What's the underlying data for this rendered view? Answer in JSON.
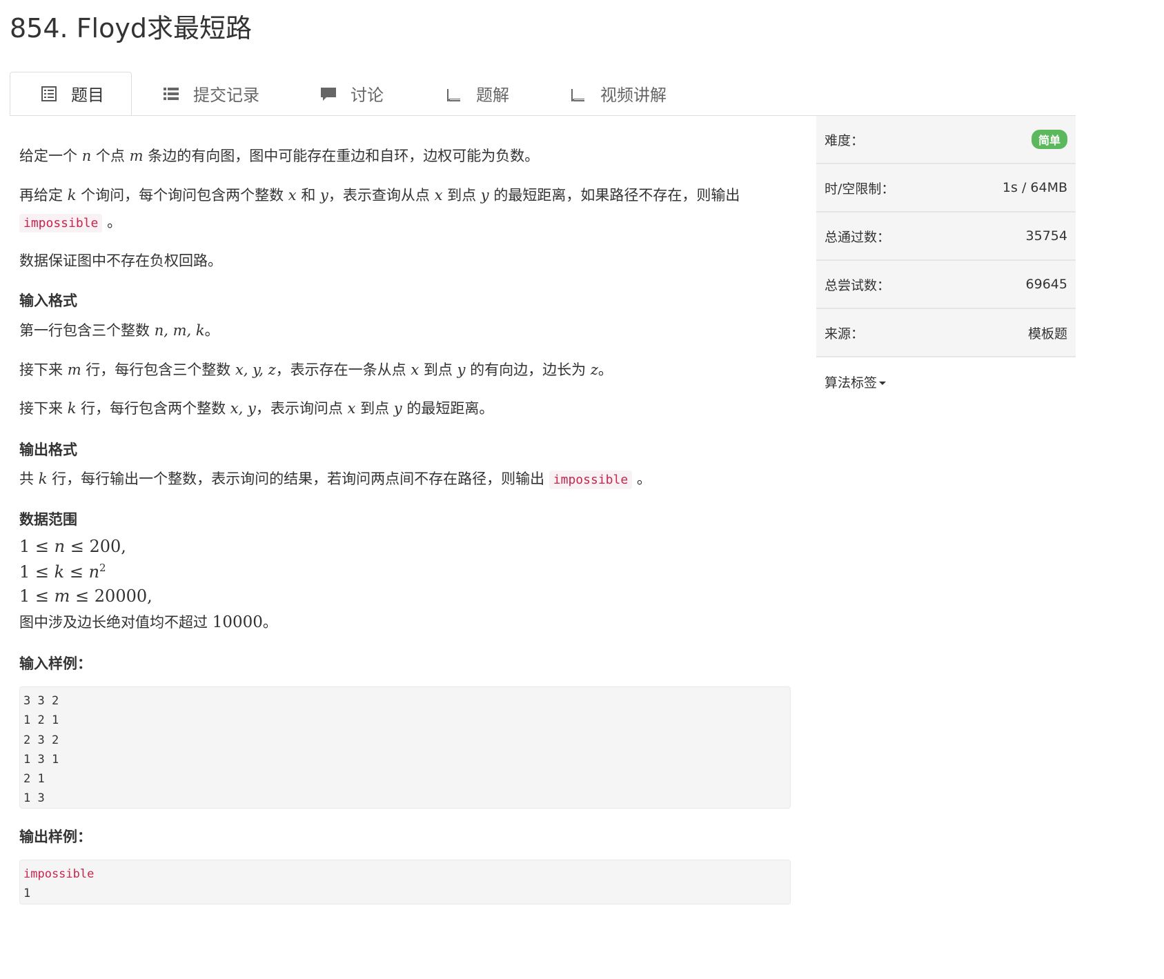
{
  "problem": {
    "title": "854. Floyd求最短路"
  },
  "tabs": [
    {
      "label": "题目",
      "icon": "list-alt-icon"
    },
    {
      "label": "提交记录",
      "icon": "list-icon"
    },
    {
      "label": "讨论",
      "icon": "comment-icon"
    },
    {
      "label": "题解",
      "icon": "book-icon"
    },
    {
      "label": "视频讲解",
      "icon": "book-icon"
    }
  ],
  "desc": {
    "p1_a": "给定一个",
    "p1_n": "n",
    "p1_b": "个点",
    "p1_m": "m",
    "p1_c": "条边的有向图，图中可能存在重边和自环，边权可能为负数。",
    "p2_a": "再给定",
    "p2_k": "k",
    "p2_b": "个询问，每个询问包含两个整数",
    "p2_x": "x",
    "p2_c": "和",
    "p2_y": "y",
    "p2_d": "，表示查询从点",
    "p2_x2": "x",
    "p2_e": "到点",
    "p2_y2": "y",
    "p2_f": "的最短距离，如果路径不存在，则输出",
    "p2_code": "impossible",
    "p2_end": "。",
    "p3": "数据保证图中不存在负权回路。"
  },
  "input_format": {
    "heading": "输入格式",
    "l1_a": "第一行包含三个整数",
    "l1_math": "n, m, k",
    "l1_end": "。",
    "l2_a": "接下来",
    "l2_m": "m",
    "l2_b": "行，每行包含三个整数",
    "l2_math": "x, y, z",
    "l2_c": "，表示存在一条从点",
    "l2_x": "x",
    "l2_d": "到点",
    "l2_y": "y",
    "l2_e": "的有向边，边长为",
    "l2_z": "z",
    "l2_end": "。",
    "l3_a": "接下来",
    "l3_k": "k",
    "l3_b": "行，每行包含两个整数",
    "l3_math": "x, y",
    "l3_c": "，表示询问点",
    "l3_x": "x",
    "l3_d": "到点",
    "l3_y": "y",
    "l3_e": "的最短距离。"
  },
  "output_format": {
    "heading": "输出格式",
    "a": "共",
    "k": "k",
    "b": "行，每行输出一个整数，表示询问的结果，若询问两点间不存在路径，则输出",
    "code": "impossible",
    "end": "。"
  },
  "range": {
    "heading": "数据范围",
    "r1_a": "1 ≤ ",
    "r1_v": "n",
    "r1_b": " ≤ 200,",
    "r2_a": "1 ≤ ",
    "r2_v": "k",
    "r2_b": " ≤ ",
    "r2_c": "n",
    "r2_sup": "2",
    "r3_a": "1 ≤ ",
    "r3_v": "m",
    "r3_b": " ≤ 20000,",
    "r4_a": "图中涉及边长绝对值均不超过",
    "r4_num": "10000",
    "r4_end": "。"
  },
  "sample_input": {
    "heading": "输入样例：",
    "text": "3 3 2\n1 2 1\n2 3 2\n1 3 1\n2 1\n1 3"
  },
  "sample_output": {
    "heading": "输出样例：",
    "line1": "impossible",
    "line2": "1"
  },
  "sidebar": {
    "difficulty_label": "难度：",
    "difficulty_value": "简单",
    "limit_label": "时/空限制：",
    "limit_value": "1s / 64MB",
    "passed_label": "总通过数：",
    "passed_value": "35754",
    "tried_label": "总尝试数：",
    "tried_value": "69645",
    "source_label": "来源：",
    "source_value": "模板题",
    "tags_label": "算法标签"
  },
  "colors": {
    "accent_code": "#c7254e",
    "badge_green": "#5cb85c"
  }
}
